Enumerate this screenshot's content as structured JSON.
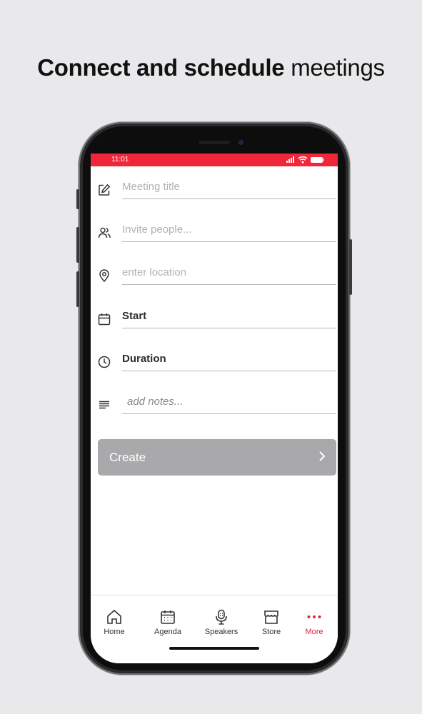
{
  "headline": {
    "bold": "Connect and schedule",
    "regular": "meetings"
  },
  "statusbar": {
    "time": "11:01"
  },
  "form": {
    "title_placeholder": "Meeting title",
    "invite_placeholder": "Invite people...",
    "location_placeholder": "enter location",
    "start_label": "Start",
    "duration_label": "Duration",
    "notes_placeholder": "add notes...",
    "create_label": "Create"
  },
  "tabs": [
    {
      "label": "Home",
      "icon": "home-icon"
    },
    {
      "label": "Agenda",
      "icon": "calendar-icon"
    },
    {
      "label": "Speakers",
      "icon": "microphone-icon"
    },
    {
      "label": "Store",
      "icon": "store-icon"
    },
    {
      "label": "More",
      "icon": "more-dots-icon",
      "active": true
    }
  ],
  "colors": {
    "accent": "#f0263a",
    "button_disabled": "#a9a9ab",
    "background": "#e9e8ea"
  }
}
